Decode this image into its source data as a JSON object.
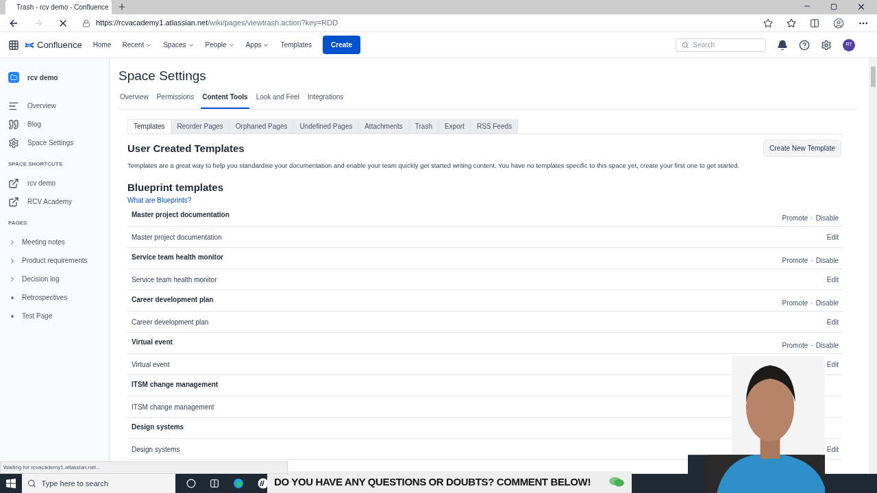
{
  "browser": {
    "tab_title": "Trash - rcv demo - Confluence",
    "url_host": "https://rcvacademy1.atlassian.net",
    "url_path": "/wiki/pages/viewtrash.action?key=RDD",
    "status": "Waiting for rcvacademy1.atlassian.net..."
  },
  "topnav": {
    "product": "Confluence",
    "items": [
      {
        "label": "Home",
        "dropdown": false
      },
      {
        "label": "Recent",
        "dropdown": true
      },
      {
        "label": "Spaces",
        "dropdown": true
      },
      {
        "label": "People",
        "dropdown": true
      },
      {
        "label": "Apps",
        "dropdown": true
      },
      {
        "label": "Templates",
        "dropdown": false
      }
    ],
    "create": "Create",
    "search_placeholder": "Search",
    "avatar": "RT"
  },
  "sidebar": {
    "space": "rcv demo",
    "items": [
      {
        "label": "Overview",
        "kind": "overview"
      },
      {
        "label": "Blog",
        "kind": "blog"
      },
      {
        "label": "Space Settings",
        "kind": "settings"
      }
    ],
    "shortcuts_heading": "SPACE SHORTCUTS",
    "shortcuts": [
      "rcv demo",
      "RCV Academy"
    ],
    "pages_heading": "PAGES",
    "pages": [
      {
        "label": "Meeting notes",
        "kind": "expandable"
      },
      {
        "label": "Product requirements",
        "kind": "expandable"
      },
      {
        "label": "Decision log",
        "kind": "expandable"
      },
      {
        "label": "Retrospectives",
        "kind": "leaf"
      },
      {
        "label": "Test Page",
        "kind": "leaf"
      }
    ]
  },
  "page": {
    "title": "Space Settings",
    "tabs": [
      {
        "label": "Overview",
        "selected": false
      },
      {
        "label": "Permissions",
        "selected": false
      },
      {
        "label": "Content Tools",
        "selected": true
      },
      {
        "label": "Look and Feel",
        "selected": false
      },
      {
        "label": "Integrations",
        "selected": false
      }
    ],
    "subtabs": [
      {
        "label": "Templates",
        "selected": true
      },
      {
        "label": "Reorder Pages",
        "selected": false
      },
      {
        "label": "Orphaned Pages",
        "selected": false
      },
      {
        "label": "Undefined Pages",
        "selected": false
      },
      {
        "label": "Attachments",
        "selected": false
      },
      {
        "label": "Trash",
        "selected": false
      },
      {
        "label": "Export",
        "selected": false
      },
      {
        "label": "RSS Feeds",
        "selected": false
      }
    ],
    "user_heading": "User Created Templates",
    "create_button": "Create New Template",
    "user_text": "Templates are a great way to help you standardise your documentation and enable your team quickly get started writing content. You have no templates specific to this space yet, create your first one to get started.",
    "blueprint_heading": "Blueprint templates",
    "blueprint_link": "What are Blueprints?",
    "blueprints": [
      {
        "name": "Master project documentation",
        "promote": "Promote",
        "separator": "·",
        "disable": "Disable",
        "item": "Master project documentation",
        "edit": "Edit"
      },
      {
        "name": "Service team health monitor",
        "promote": "Promote",
        "separator": "·",
        "disable": "Disable",
        "item": "Service team health monitor",
        "edit": "Edit"
      },
      {
        "name": "Career development plan",
        "promote": "Promote",
        "separator": "·",
        "disable": "Disable",
        "item": "Career development plan",
        "edit": "Edit"
      },
      {
        "name": "Virtual event",
        "promote": "Promote",
        "separator": "·",
        "disable": "Disable",
        "item": "Virtual event",
        "edit": "Edit"
      },
      {
        "name": "ITSM change management",
        "item": "ITSM change management"
      },
      {
        "name": "Design systems",
        "item": "Design systems",
        "edit": "Edit"
      }
    ]
  },
  "taskbar": {
    "search_placeholder": "Type here to search"
  },
  "banner": "DO YOU HAVE ANY QUESTIONS OR DOUBTS? COMMENT BELOW!"
}
